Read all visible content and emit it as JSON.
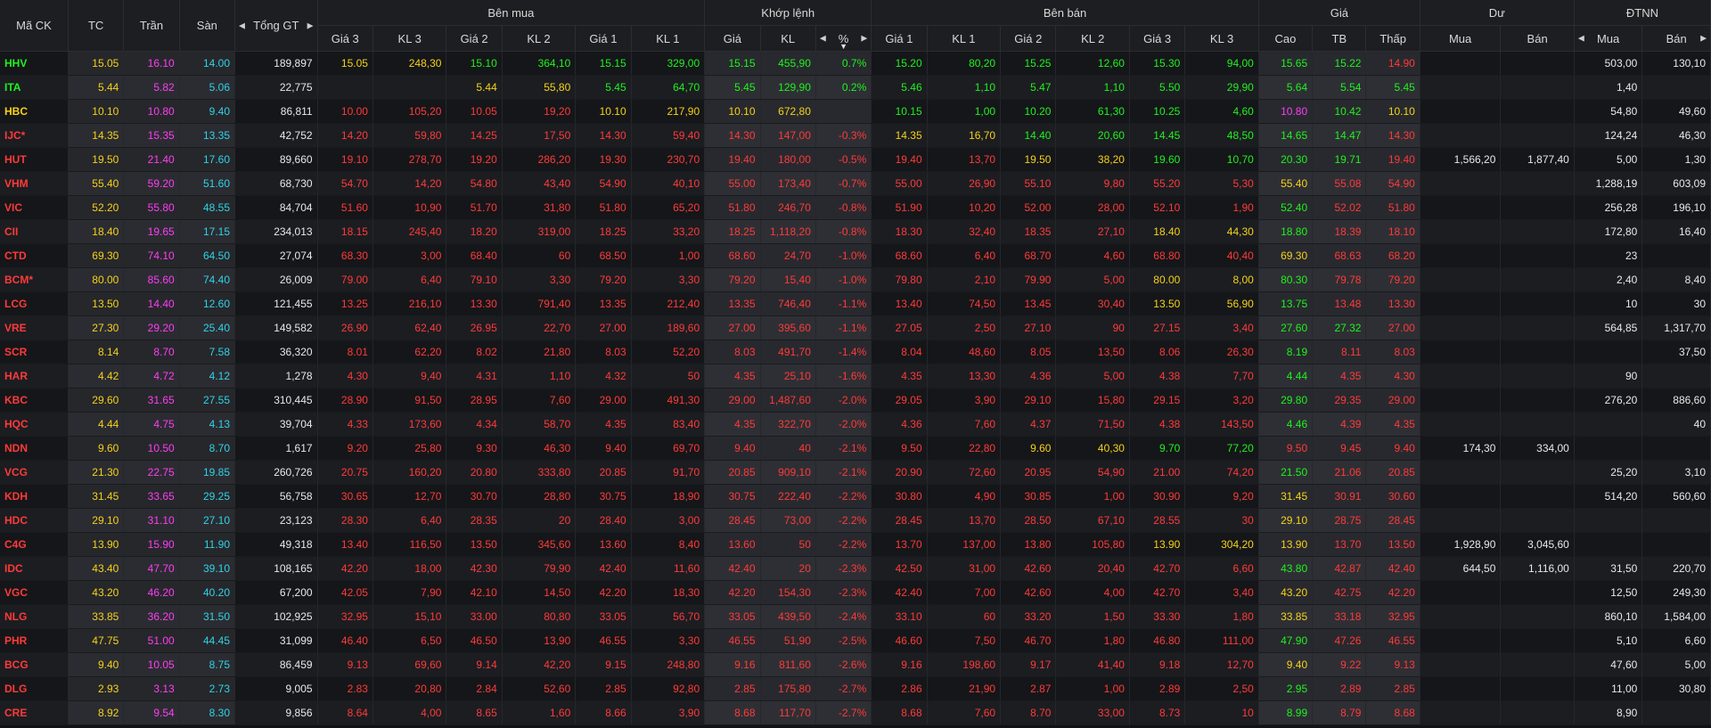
{
  "colors": {
    "up": "#1ef31e",
    "down": "#ff3a3a",
    "ref": "#f5d21a",
    "ceil": "#ff3df5",
    "floor": "#2fd3e8",
    "white": "#e8e8e8"
  },
  "headers": {
    "symbol": "Mã CK",
    "tc": "TC",
    "tran": "Trần",
    "san": "Sàn",
    "tong_gt": "Tổng GT",
    "ben_mua": "Bên mua",
    "khop_lenh": "Khớp lệnh",
    "ben_ban": "Bên bán",
    "gia": "Giá",
    "du": "Dư",
    "dtnn": "ĐTNN",
    "gia3": "Giá 3",
    "kl3": "KL 3",
    "gia2": "Giá 2",
    "kl2": "KL 2",
    "gia1": "Giá 1",
    "kl1": "KL 1",
    "m_gia": "Giá",
    "m_kl": "KL",
    "m_pct": "%",
    "s_gia1": "Giá 1",
    "s_kl1": "KL 1",
    "s_gia2": "Giá 2",
    "s_kl2": "KL 2",
    "s_gia3": "Giá 3",
    "s_kl3": "KL 3",
    "cao": "Cao",
    "tb": "TB",
    "thap": "Thấp",
    "du_mua": "Mua",
    "du_ban": "Bán",
    "nn_mua": "Mua",
    "nn_ban": "Bán"
  },
  "icons": {
    "left": "left-arrow-icon",
    "right": "right-arrow-icon",
    "sort": "sort-desc-icon"
  },
  "rows": [
    [
      "HHV",
      "15.05",
      "16.10",
      "14.00",
      "189,897",
      "15.05",
      "248,30",
      "15.10",
      "364,10",
      "15.15",
      "329,00",
      "15.15",
      "455,90",
      "0.7%",
      "15.20",
      "80,20",
      "15.25",
      "12,60",
      "15.30",
      "94,00",
      "15.65",
      "15.22",
      "14.90",
      "",
      "",
      "503,00",
      "130,10"
    ],
    [
      "ITA",
      "5.44",
      "5.82",
      "5.06",
      "22,775",
      "",
      "",
      "5.44",
      "55,80",
      "5.45",
      "64,70",
      "5.45",
      "129,90",
      "0.2%",
      "5.46",
      "1,10",
      "5.47",
      "1,10",
      "5.50",
      "29,90",
      "5.64",
      "5.54",
      "5.45",
      "",
      "",
      "1,40",
      ""
    ],
    [
      "HBC",
      "10.10",
      "10.80",
      "9.40",
      "86,811",
      "10.00",
      "105,20",
      "10.05",
      "19,20",
      "10.10",
      "217,90",
      "10.10",
      "672,80",
      "",
      "10.15",
      "1,00",
      "10.20",
      "61,30",
      "10.25",
      "4,60",
      "10.80",
      "10.42",
      "10.10",
      "",
      "",
      "54,80",
      "49,60"
    ],
    [
      "IJC*",
      "14.35",
      "15.35",
      "13.35",
      "42,752",
      "14.20",
      "59,80",
      "14.25",
      "17,50",
      "14.30",
      "59,40",
      "14.30",
      "147,00",
      "-0.3%",
      "14.35",
      "16,70",
      "14.40",
      "20,60",
      "14.45",
      "48,50",
      "14.65",
      "14.47",
      "14.30",
      "",
      "",
      "124,24",
      "46,30"
    ],
    [
      "HUT",
      "19.50",
      "21.40",
      "17.60",
      "89,660",
      "19.10",
      "278,70",
      "19.20",
      "286,20",
      "19.30",
      "230,70",
      "19.40",
      "180,00",
      "-0.5%",
      "19.40",
      "13,70",
      "19.50",
      "38,20",
      "19.60",
      "10,70",
      "20.30",
      "19.71",
      "19.40",
      "1,566,20",
      "1,877,40",
      "5,00",
      "1,30"
    ],
    [
      "VHM",
      "55.40",
      "59.20",
      "51.60",
      "68,730",
      "54.70",
      "14,20",
      "54.80",
      "43,40",
      "54.90",
      "40,10",
      "55.00",
      "173,40",
      "-0.7%",
      "55.00",
      "26,90",
      "55.10",
      "9,80",
      "55.20",
      "5,30",
      "55.40",
      "55.08",
      "54.90",
      "",
      "",
      "1,288,19",
      "603,09"
    ],
    [
      "VIC",
      "52.20",
      "55.80",
      "48.55",
      "84,704",
      "51.60",
      "10,90",
      "51.70",
      "31,80",
      "51.80",
      "65,20",
      "51.80",
      "246,70",
      "-0.8%",
      "51.90",
      "10,20",
      "52.00",
      "28,00",
      "52.10",
      "1,90",
      "52.40",
      "52.02",
      "51.80",
      "",
      "",
      "256,28",
      "196,10"
    ],
    [
      "CII",
      "18.40",
      "19.65",
      "17.15",
      "234,013",
      "18.15",
      "245,40",
      "18.20",
      "319,00",
      "18.25",
      "33,20",
      "18.25",
      "1,118,20",
      "-0.8%",
      "18.30",
      "32,40",
      "18.35",
      "27,10",
      "18.40",
      "44,30",
      "18.80",
      "18.39",
      "18.10",
      "",
      "",
      "172,80",
      "16,40"
    ],
    [
      "CTD",
      "69.30",
      "74.10",
      "64.50",
      "27,074",
      "68.30",
      "3,00",
      "68.40",
      "60",
      "68.50",
      "1,00",
      "68.60",
      "24,70",
      "-1.0%",
      "68.60",
      "6,40",
      "68.70",
      "4,60",
      "68.80",
      "40,40",
      "69.30",
      "68.63",
      "68.20",
      "",
      "",
      "23",
      ""
    ],
    [
      "BCM*",
      "80.00",
      "85.60",
      "74.40",
      "26,009",
      "79.00",
      "6,40",
      "79.10",
      "3,30",
      "79.20",
      "3,30",
      "79.20",
      "15,40",
      "-1.0%",
      "79.80",
      "2,10",
      "79.90",
      "5,00",
      "80.00",
      "8,00",
      "80.30",
      "79.78",
      "79.20",
      "",
      "",
      "2,40",
      "8,40"
    ],
    [
      "LCG",
      "13.50",
      "14.40",
      "12.60",
      "121,455",
      "13.25",
      "216,10",
      "13.30",
      "791,40",
      "13.35",
      "212,40",
      "13.35",
      "746,40",
      "-1.1%",
      "13.40",
      "74,50",
      "13.45",
      "30,40",
      "13.50",
      "56,90",
      "13.75",
      "13.48",
      "13.30",
      "",
      "",
      "10",
      "30"
    ],
    [
      "VRE",
      "27.30",
      "29.20",
      "25.40",
      "149,582",
      "26.90",
      "62,40",
      "26.95",
      "22,70",
      "27.00",
      "189,60",
      "27.00",
      "395,60",
      "-1.1%",
      "27.05",
      "2,50",
      "27.10",
      "90",
      "27.15",
      "3,40",
      "27.60",
      "27.32",
      "27.00",
      "",
      "",
      "564,85",
      "1,317,70"
    ],
    [
      "SCR",
      "8.14",
      "8.70",
      "7.58",
      "36,320",
      "8.01",
      "62,20",
      "8.02",
      "21,80",
      "8.03",
      "52,20",
      "8.03",
      "491,70",
      "-1.4%",
      "8.04",
      "48,60",
      "8.05",
      "13,50",
      "8.06",
      "26,30",
      "8.19",
      "8.11",
      "8.03",
      "",
      "",
      "",
      "37,50"
    ],
    [
      "HAR",
      "4.42",
      "4.72",
      "4.12",
      "1,278",
      "4.30",
      "9,40",
      "4.31",
      "1,10",
      "4.32",
      "50",
      "4.35",
      "25,10",
      "-1.6%",
      "4.35",
      "13,30",
      "4.36",
      "5,00",
      "4.38",
      "7,70",
      "4.44",
      "4.35",
      "4.30",
      "",
      "",
      "90",
      ""
    ],
    [
      "KBC",
      "29.60",
      "31.65",
      "27.55",
      "310,445",
      "28.90",
      "91,50",
      "28.95",
      "7,60",
      "29.00",
      "491,30",
      "29.00",
      "1,487,60",
      "-2.0%",
      "29.05",
      "3,90",
      "29.10",
      "15,80",
      "29.15",
      "3,20",
      "29.80",
      "29.35",
      "29.00",
      "",
      "",
      "276,20",
      "886,60"
    ],
    [
      "HQC",
      "4.44",
      "4.75",
      "4.13",
      "39,704",
      "4.33",
      "173,60",
      "4.34",
      "58,70",
      "4.35",
      "83,40",
      "4.35",
      "322,70",
      "-2.0%",
      "4.36",
      "7,60",
      "4.37",
      "71,50",
      "4.38",
      "143,50",
      "4.46",
      "4.39",
      "4.35",
      "",
      "",
      "",
      "40"
    ],
    [
      "NDN",
      "9.60",
      "10.50",
      "8.70",
      "1,617",
      "9.20",
      "25,80",
      "9.30",
      "46,30",
      "9.40",
      "69,70",
      "9.40",
      "40",
      "-2.1%",
      "9.50",
      "22,80",
      "9.60",
      "40,30",
      "9.70",
      "77,20",
      "9.50",
      "9.45",
      "9.40",
      "174,30",
      "334,00",
      "",
      ""
    ],
    [
      "VCG",
      "21.30",
      "22.75",
      "19.85",
      "260,726",
      "20.75",
      "160,20",
      "20.80",
      "333,80",
      "20.85",
      "91,70",
      "20.85",
      "909,10",
      "-2.1%",
      "20.90",
      "72,60",
      "20.95",
      "54,90",
      "21.00",
      "74,20",
      "21.50",
      "21.06",
      "20.85",
      "",
      "",
      "25,20",
      "3,10"
    ],
    [
      "KDH",
      "31.45",
      "33.65",
      "29.25",
      "56,758",
      "30.65",
      "12,70",
      "30.70",
      "28,80",
      "30.75",
      "18,90",
      "30.75",
      "222,40",
      "-2.2%",
      "30.80",
      "4,90",
      "30.85",
      "1,00",
      "30.90",
      "9,20",
      "31.45",
      "30.91",
      "30.60",
      "",
      "",
      "514,20",
      "560,60"
    ],
    [
      "HDC",
      "29.10",
      "31.10",
      "27.10",
      "23,123",
      "28.30",
      "6,40",
      "28.35",
      "20",
      "28.40",
      "3,00",
      "28.45",
      "73,00",
      "-2.2%",
      "28.45",
      "13,70",
      "28.50",
      "67,10",
      "28.55",
      "30",
      "29.10",
      "28.75",
      "28.45",
      "",
      "",
      "",
      ""
    ],
    [
      "C4G",
      "13.90",
      "15.90",
      "11.90",
      "49,318",
      "13.40",
      "116,50",
      "13.50",
      "345,60",
      "13.60",
      "8,40",
      "13.60",
      "50",
      "-2.2%",
      "13.70",
      "137,00",
      "13.80",
      "105,80",
      "13.90",
      "304,20",
      "13.90",
      "13.70",
      "13.50",
      "1,928,90",
      "3,045,60",
      "",
      ""
    ],
    [
      "IDC",
      "43.40",
      "47.70",
      "39.10",
      "108,165",
      "42.20",
      "18,00",
      "42.30",
      "79,90",
      "42.40",
      "11,60",
      "42.40",
      "20",
      "-2.3%",
      "42.50",
      "31,00",
      "42.60",
      "20,40",
      "42.70",
      "6,60",
      "43.80",
      "42.87",
      "42.40",
      "644,50",
      "1,116,00",
      "31,50",
      "220,70"
    ],
    [
      "VGC",
      "43.20",
      "46.20",
      "40.20",
      "67,200",
      "42.05",
      "7,90",
      "42.10",
      "14,50",
      "42.20",
      "18,30",
      "42.20",
      "154,30",
      "-2.3%",
      "42.40",
      "7,00",
      "42.60",
      "4,00",
      "42.70",
      "3,40",
      "43.20",
      "42.75",
      "42.20",
      "",
      "",
      "12,50",
      "249,30"
    ],
    [
      "NLG",
      "33.85",
      "36.20",
      "31.50",
      "102,925",
      "32.95",
      "15,10",
      "33.00",
      "80,80",
      "33.05",
      "56,70",
      "33.05",
      "439,50",
      "-2.4%",
      "33.10",
      "60",
      "33.20",
      "1,50",
      "33.30",
      "1,80",
      "33.85",
      "33.18",
      "32.95",
      "",
      "",
      "860,10",
      "1,584,00"
    ],
    [
      "PHR",
      "47.75",
      "51.00",
      "44.45",
      "31,099",
      "46.40",
      "6,50",
      "46.50",
      "13,90",
      "46.55",
      "3,30",
      "46.55",
      "51,90",
      "-2.5%",
      "46.60",
      "7,50",
      "46.70",
      "1,80",
      "46.80",
      "111,00",
      "47.90",
      "47.26",
      "46.55",
      "",
      "",
      "5,10",
      "6,60"
    ],
    [
      "BCG",
      "9.40",
      "10.05",
      "8.75",
      "86,459",
      "9.13",
      "69,60",
      "9.14",
      "42,20",
      "9.15",
      "248,80",
      "9.16",
      "811,60",
      "-2.6%",
      "9.16",
      "198,60",
      "9.17",
      "41,40",
      "9.18",
      "12,70",
      "9.40",
      "9.22",
      "9.13",
      "",
      "",
      "47,60",
      "5,00"
    ],
    [
      "DLG",
      "2.93",
      "3.13",
      "2.73",
      "9,005",
      "2.83",
      "20,80",
      "2.84",
      "52,60",
      "2.85",
      "92,80",
      "2.85",
      "175,80",
      "-2.7%",
      "2.86",
      "21,90",
      "2.87",
      "1,00",
      "2.89",
      "2,50",
      "2.95",
      "2.89",
      "2.85",
      "",
      "",
      "11,00",
      "30,80"
    ],
    [
      "CRE",
      "8.92",
      "9.54",
      "8.30",
      "9,856",
      "8.64",
      "4,00",
      "8.65",
      "1,60",
      "8.66",
      "3,90",
      "8.68",
      "117,70",
      "-2.7%",
      "8.68",
      "7,60",
      "8.70",
      "33,00",
      "8.73",
      "10",
      "8.99",
      "8.79",
      "8.68",
      "",
      "",
      "8,90",
      ""
    ]
  ]
}
